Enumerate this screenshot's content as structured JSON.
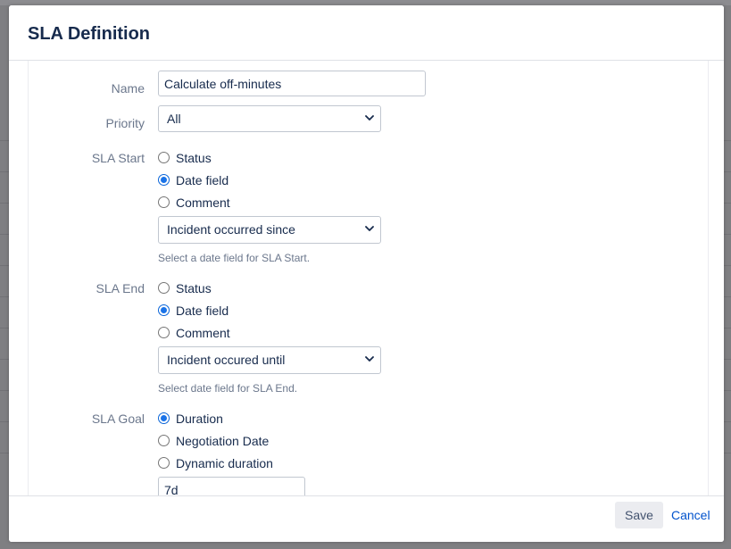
{
  "dialog": {
    "title": "SLA Definition"
  },
  "form": {
    "name": {
      "label": "Name",
      "value": "Calculate off-minutes"
    },
    "priority": {
      "label": "Priority",
      "selected": "All"
    },
    "sla_start": {
      "label": "SLA Start",
      "options": [
        {
          "label": "Status",
          "checked": false
        },
        {
          "label": "Date field",
          "checked": true
        },
        {
          "label": "Comment",
          "checked": false
        }
      ],
      "date_field_selected": "Incident occurred since",
      "help": "Select a date field for SLA Start."
    },
    "sla_end": {
      "label": "SLA End",
      "options": [
        {
          "label": "Status",
          "checked": false
        },
        {
          "label": "Date field",
          "checked": true
        },
        {
          "label": "Comment",
          "checked": false
        }
      ],
      "date_field_selected": "Incident occured until",
      "help": "Select date field for SLA End."
    },
    "sla_goal": {
      "label": "SLA Goal",
      "options": [
        {
          "label": "Duration",
          "checked": true
        },
        {
          "label": "Negotiation Date",
          "checked": false
        },
        {
          "label": "Dynamic duration",
          "checked": false
        }
      ],
      "duration_value": "7d"
    }
  },
  "footer": {
    "save_label": "Save",
    "cancel_label": "Cancel"
  },
  "colors": {
    "accent": "#0052cc",
    "radio_checked": "#1a73e8",
    "label_text": "#6b778c",
    "body_text": "#172b4d"
  },
  "icons": {
    "select_arrow": "chevron-down-icon"
  }
}
